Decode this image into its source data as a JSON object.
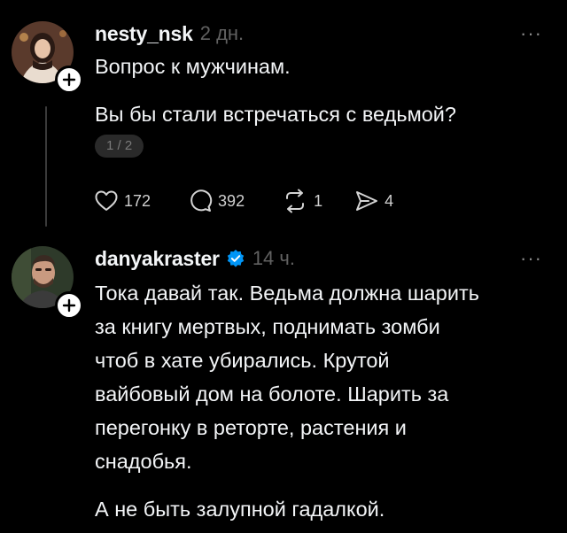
{
  "posts": [
    {
      "username": "nesty_nsk",
      "time": "2 дн.",
      "more": "···",
      "lines": [
        "Вопрос к мужчинам.",
        "Вы бы стали встречаться с ведьмой?"
      ],
      "page_indicator": "1 / 2",
      "actions": {
        "likes": "172",
        "replies": "392",
        "reposts": "1",
        "shares": "4"
      }
    },
    {
      "username": "danyakraster",
      "time": "14 ч.",
      "more": "···",
      "verified": true,
      "paragraph1": [
        "Тока давай так. Ведьма должна шарить",
        "за книгу мертвых, поднимать зомби",
        "чтоб в хате убирались. Крутой",
        "вайбовый дом на болоте. Шарить за",
        "перегонку в реторте, растения и",
        "снадобья."
      ],
      "paragraph2": "А не быть залупной гадалкой."
    }
  ],
  "colors": {
    "background": "#000000",
    "text": "#f3f5f7",
    "muted": "#616161",
    "verified": "#0095f6"
  },
  "icons": [
    "heart-icon",
    "comment-icon",
    "repost-icon",
    "share-icon",
    "plus-icon",
    "verified-icon"
  ]
}
